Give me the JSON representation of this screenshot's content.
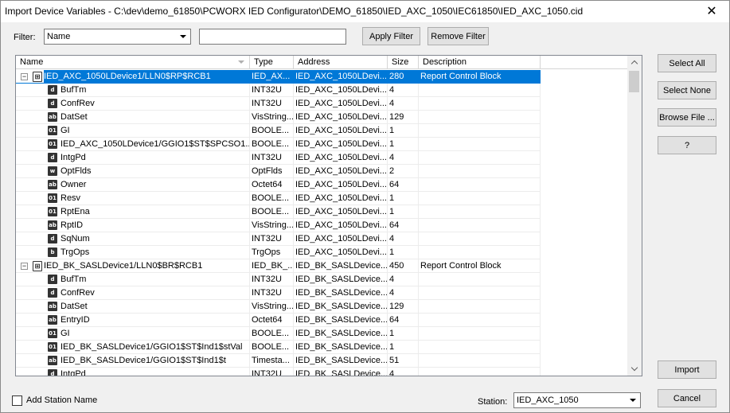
{
  "window": {
    "title": "Import Device Variables - C:\\dev\\demo_61850\\PCWORX IED Configurator\\DEMO_61850\\IED_AXC_1050\\IEC61850\\IED_AXC_1050.cid",
    "close_glyph": "✕"
  },
  "filter": {
    "label": "Filter:",
    "field_value": "Name",
    "text_value": "",
    "apply_label": "Apply Filter",
    "remove_label": "Remove Filter"
  },
  "columns": [
    "Name",
    "Type",
    "Address",
    "Size",
    "Description"
  ],
  "rows": [
    {
      "level": 0,
      "expander": "−",
      "icon": "rcb",
      "name": "IED_AXC_1050LDevice1/LLN0$RP$RCB1",
      "type": "IED_AX...",
      "address": "IED_AXC_1050LDevi...",
      "size": "280",
      "desc": "Report Control Block",
      "selected": true
    },
    {
      "level": 1,
      "icon": "d",
      "name": "BufTm",
      "type": "INT32U",
      "address": "IED_AXC_1050LDevi...",
      "size": "4",
      "desc": ""
    },
    {
      "level": 1,
      "icon": "d",
      "name": "ConfRev",
      "type": "INT32U",
      "address": "IED_AXC_1050LDevi...",
      "size": "4",
      "desc": ""
    },
    {
      "level": 1,
      "icon": "ab",
      "name": "DatSet",
      "type": "VisString...",
      "address": "IED_AXC_1050LDevi...",
      "size": "129",
      "desc": ""
    },
    {
      "level": 1,
      "icon": "01",
      "name": "GI",
      "type": "BOOLE...",
      "address": "IED_AXC_1050LDevi...",
      "size": "1",
      "desc": ""
    },
    {
      "level": 1,
      "icon": "01",
      "name": "IED_AXC_1050LDevice1/GGIO1$ST$SPCSO1...",
      "type": "BOOLE...",
      "address": "IED_AXC_1050LDevi...",
      "size": "1",
      "desc": ""
    },
    {
      "level": 1,
      "icon": "d",
      "name": "IntgPd",
      "type": "INT32U",
      "address": "IED_AXC_1050LDevi...",
      "size": "4",
      "desc": ""
    },
    {
      "level": 1,
      "icon": "w",
      "name": "OptFlds",
      "type": "OptFlds",
      "address": "IED_AXC_1050LDevi...",
      "size": "2",
      "desc": ""
    },
    {
      "level": 1,
      "icon": "ab",
      "name": "Owner",
      "type": "Octet64",
      "address": "IED_AXC_1050LDevi...",
      "size": "64",
      "desc": ""
    },
    {
      "level": 1,
      "icon": "01",
      "name": "Resv",
      "type": "BOOLE...",
      "address": "IED_AXC_1050LDevi...",
      "size": "1",
      "desc": ""
    },
    {
      "level": 1,
      "icon": "01",
      "name": "RptEna",
      "type": "BOOLE...",
      "address": "IED_AXC_1050LDevi...",
      "size": "1",
      "desc": ""
    },
    {
      "level": 1,
      "icon": "ab",
      "name": "RptID",
      "type": "VisString...",
      "address": "IED_AXC_1050LDevi...",
      "size": "64",
      "desc": ""
    },
    {
      "level": 1,
      "icon": "d",
      "name": "SqNum",
      "type": "INT32U",
      "address": "IED_AXC_1050LDevi...",
      "size": "4",
      "desc": ""
    },
    {
      "level": 1,
      "icon": "b",
      "name": "TrgOps",
      "type": "TrgOps",
      "address": "IED_AXC_1050LDevi...",
      "size": "1",
      "desc": ""
    },
    {
      "level": 0,
      "expander": "−",
      "icon": "rcb",
      "name": "IED_BK_SASLDevice1/LLN0$BR$RCB1",
      "type": "IED_BK_...",
      "address": "IED_BK_SASLDevice...",
      "size": "450",
      "desc": "Report Control Block"
    },
    {
      "level": 1,
      "icon": "d",
      "name": "BufTm",
      "type": "INT32U",
      "address": "IED_BK_SASLDevice...",
      "size": "4",
      "desc": ""
    },
    {
      "level": 1,
      "icon": "d",
      "name": "ConfRev",
      "type": "INT32U",
      "address": "IED_BK_SASLDevice...",
      "size": "4",
      "desc": ""
    },
    {
      "level": 1,
      "icon": "ab",
      "name": "DatSet",
      "type": "VisString...",
      "address": "IED_BK_SASLDevice...",
      "size": "129",
      "desc": ""
    },
    {
      "level": 1,
      "icon": "ab",
      "name": "EntryID",
      "type": "Octet64",
      "address": "IED_BK_SASLDevice...",
      "size": "64",
      "desc": ""
    },
    {
      "level": 1,
      "icon": "01",
      "name": "GI",
      "type": "BOOLE...",
      "address": "IED_BK_SASLDevice...",
      "size": "1",
      "desc": ""
    },
    {
      "level": 1,
      "icon": "01",
      "name": "IED_BK_SASLDevice1/GGIO1$ST$Ind1$stVal",
      "type": "BOOLE...",
      "address": "IED_BK_SASLDevice...",
      "size": "1",
      "desc": ""
    },
    {
      "level": 1,
      "icon": "ab",
      "name": "IED_BK_SASLDevice1/GGIO1$ST$Ind1$t",
      "type": "Timesta...",
      "address": "IED_BK_SASLDevice...",
      "size": "51",
      "desc": ""
    },
    {
      "level": 1,
      "icon": "d",
      "name": "IntgPd",
      "type": "INT32U",
      "address": "IED_BK_SASLDevice...",
      "size": "4",
      "desc": ""
    }
  ],
  "side_buttons": {
    "select_all": "Select All",
    "select_none": "Select None",
    "browse_file": "Browse File ...",
    "help": "?",
    "import": "Import",
    "cancel": "Cancel"
  },
  "footer": {
    "add_station_label": "Add Station Name",
    "add_station_checked": false,
    "station_label": "Station:",
    "station_value": "IED_AXC_1050"
  },
  "colors": {
    "selection": "#0078d7",
    "background": "#f0f0f0"
  }
}
